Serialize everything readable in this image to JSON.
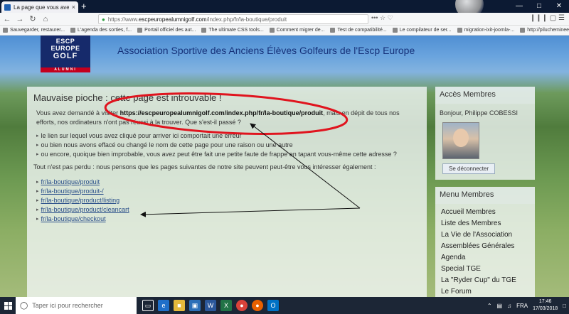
{
  "browser": {
    "tab_title": "La page que vous avez demandé",
    "tab_close": "×",
    "new_tab": "+",
    "url_prefix": "https://www.",
    "url_domain": "escpeuropealumnigolf.com",
    "url_path": "/index.php/fr/la-boutique/produit",
    "page_actions": "•••  ☆  ♡",
    "tool_icons": "❙❙❙  ▢  ☰",
    "nav_back": "←",
    "nav_forward": "→",
    "nav_reload": "↻",
    "nav_home": "⌂",
    "bookmarks": [
      "Sauvegarder, restaurer...",
      "L'agenda des sorties, f...",
      "Portail officiel des aut...",
      "The ultimate CSS tools...",
      "Comment migrer de...",
      "Test de compatibilité...",
      "Le compilateur de ser...",
      "migration-ixit-joomla-...",
      "http://pilucheminee..."
    ]
  },
  "site": {
    "logo_line1": "ESCP",
    "logo_line2": "EUROPE",
    "logo_line3": "GOLF",
    "logo_band": "ALUMNI",
    "title": "Association Sportive des Anciens Élèves Golfeurs de l'Escp Europe"
  },
  "error": {
    "heading": "Mauvaise pioche : cette page est introuvable !",
    "intro_before": "Vous avez demandé à visiter ",
    "intro_url": "https://escpeuropealumnigolf.com/index.php/fr/la-boutique/produit",
    "intro_after": ", mais en dépit de tous nos efforts, nos ordinateurs n'ont pas réussi à la trouver. Que s'est-il passé ?",
    "reasons": [
      "le lien sur lequel vous avez cliqué pour arriver ici comportait une erreur",
      "ou bien nous avons effacé ou changé le nom de cette page pour une raison ou une autre",
      "ou encore, quoique bien improbable, vous avez peut être fait une petite faute de frappe en tapant vous-même cette adresse ?"
    ],
    "fallback": "Tout n'est pas perdu : nous pensons que les pages suivantes de notre site peuvent peut-être vous intéresser également :",
    "links": [
      "fr/la-boutique/produit",
      "fr/la-boutique/produit-/",
      "fr/la-boutique/product/listing",
      "fr/la-boutique/product/cleancart",
      "fr/la-boutique/checkout"
    ]
  },
  "sidebar": {
    "access_title": "Accès Membres",
    "greeting": "Bonjour, Philippe COBESSI",
    "logout": "Se déconnecter",
    "menu_title": "Menu Membres",
    "menu": [
      "Accueil Membres",
      "Liste des Membres",
      "La Vie de l'Association",
      "Assemblées Générales",
      "Agenda",
      "Special TGE",
      "La \"Ryder Cup\" du TGE",
      "Le Forum"
    ]
  },
  "taskbar": {
    "search_placeholder": "Taper ici pour rechercher",
    "lang": "FRA",
    "time": "17:46",
    "date": "17/03/2018"
  },
  "colors": {
    "annotation": "#e0141e",
    "arrow": "#111111"
  }
}
